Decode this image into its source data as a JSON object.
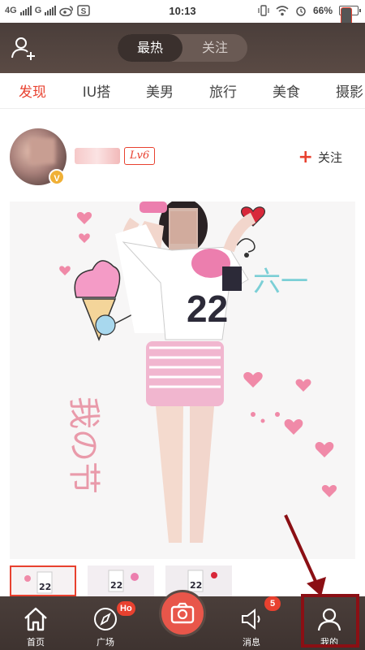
{
  "status_bar": {
    "network_1": "4G",
    "network_2": "G",
    "time": "10:13",
    "battery": "66%",
    "icons": [
      "weibo-icon",
      "s-app-icon",
      "vibrate-icon",
      "wifi-icon",
      "alarm-icon",
      "battery-icon"
    ]
  },
  "header": {
    "add_user_icon": "add-user-icon",
    "tabs": [
      {
        "label": "最热",
        "active": true
      },
      {
        "label": "关注",
        "active": false
      }
    ]
  },
  "categories": [
    {
      "label": "发现",
      "active": true
    },
    {
      "label": "IU搭",
      "active": false
    },
    {
      "label": "美男",
      "active": false
    },
    {
      "label": "旅行",
      "active": false
    },
    {
      "label": "美食",
      "active": false
    },
    {
      "label": "摄影",
      "active": false
    }
  ],
  "post": {
    "avatar_badge": "V",
    "username": "",
    "level": "Lv6",
    "follow_label": "关注",
    "photo_doodles": [
      "我の节",
      "六一"
    ]
  },
  "thumbnails": [
    {
      "active": true
    },
    {
      "active": false
    },
    {
      "active": false
    }
  ],
  "bottom_nav": {
    "items": [
      {
        "label": "首页",
        "icon": "home-icon"
      },
      {
        "label": "广场",
        "icon": "compass-icon",
        "badge": "Ho"
      },
      {
        "label": "",
        "icon": "camera-icon"
      },
      {
        "label": "消息",
        "icon": "speaker-icon",
        "badge": "5"
      },
      {
        "label": "我的",
        "icon": "profile-icon"
      }
    ]
  },
  "colors": {
    "accent": "#e8412f",
    "header_bg": "#4a3e3a",
    "camera": "#e8564a",
    "highlight": "#8b0f14"
  }
}
